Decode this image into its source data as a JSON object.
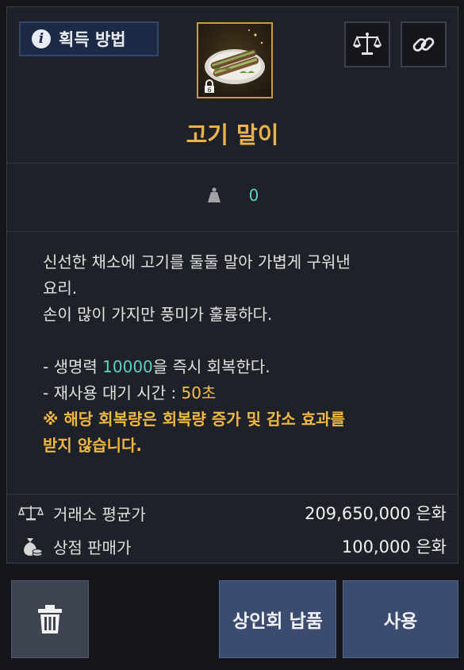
{
  "header": {
    "acquire_label": "획득 방법",
    "info_icon_glyph": "i",
    "compare_icon": "scale-icon",
    "link_icon": "link-icon"
  },
  "item": {
    "name": "고기 말이",
    "weight": "0",
    "lock_glyph": "6"
  },
  "description": {
    "line1": "신선한 채소에 고기를 둘둘 말아 가볍게 구워낸",
    "line2": "요리.",
    "line3": "손이 많이 가지만 풍미가 훌륭하다.",
    "effect1_pre": "- 생명력 ",
    "effect1_value": "10000",
    "effect1_post": "을 즉시 회복한다.",
    "effect2_pre": "- 재사용 대기 시간 : ",
    "effect2_value": "50초",
    "note_line1": "※ 해당 회복량은 회복량 증가 및 감소 효과를",
    "note_line2": "받지 않습니다."
  },
  "prices": {
    "market_label": "거래소 평균가",
    "market_value": "209,650,000 은화",
    "shop_label": "상점 판매가",
    "shop_value": "100,000 은화"
  },
  "buttons": {
    "delete_icon": "trash-icon",
    "deliver_label": "상인회 납품",
    "use_label": "사용"
  },
  "colors": {
    "item_name": "#e9b24d",
    "highlight_teal": "#5fd1c4",
    "highlight_gold": "#f0c04a",
    "button_blue": "#3c4c70"
  }
}
